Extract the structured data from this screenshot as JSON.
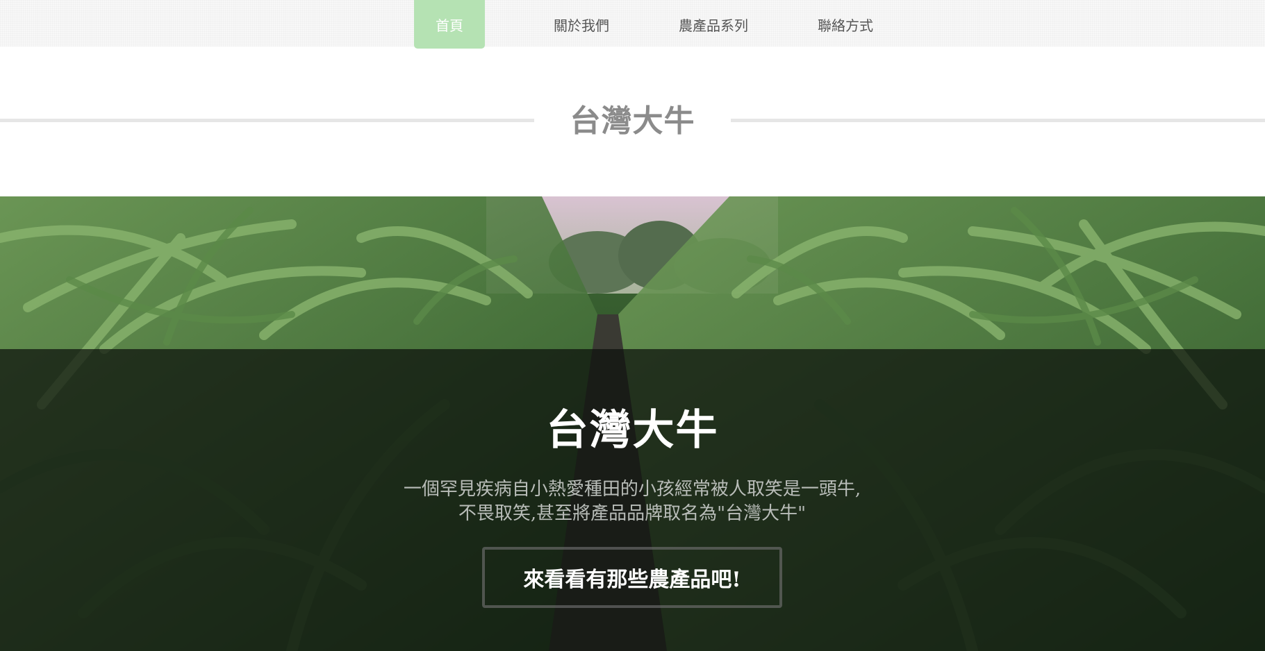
{
  "nav": {
    "items": [
      {
        "label": "首頁",
        "active": true
      },
      {
        "label": "關於我們",
        "active": false
      },
      {
        "label": "農產品系列",
        "active": false
      },
      {
        "label": "聯絡方式",
        "active": false
      }
    ]
  },
  "section": {
    "title": "台灣大牛"
  },
  "hero": {
    "heading": "台灣大牛",
    "description_line1": "一個罕見疾病自小熱愛種田的小孩經常被人取笑是一頭牛,",
    "description_line2": "不畏取笑,甚至將產品品牌取名為\"台灣大牛\"",
    "cta_label": "來看看有那些農產品吧!",
    "background_image": "corn-field-photo"
  },
  "colors": {
    "nav_active": "#b5e2b3",
    "title_text": "#8b8b8b",
    "title_rule": "#e6e6e6"
  }
}
